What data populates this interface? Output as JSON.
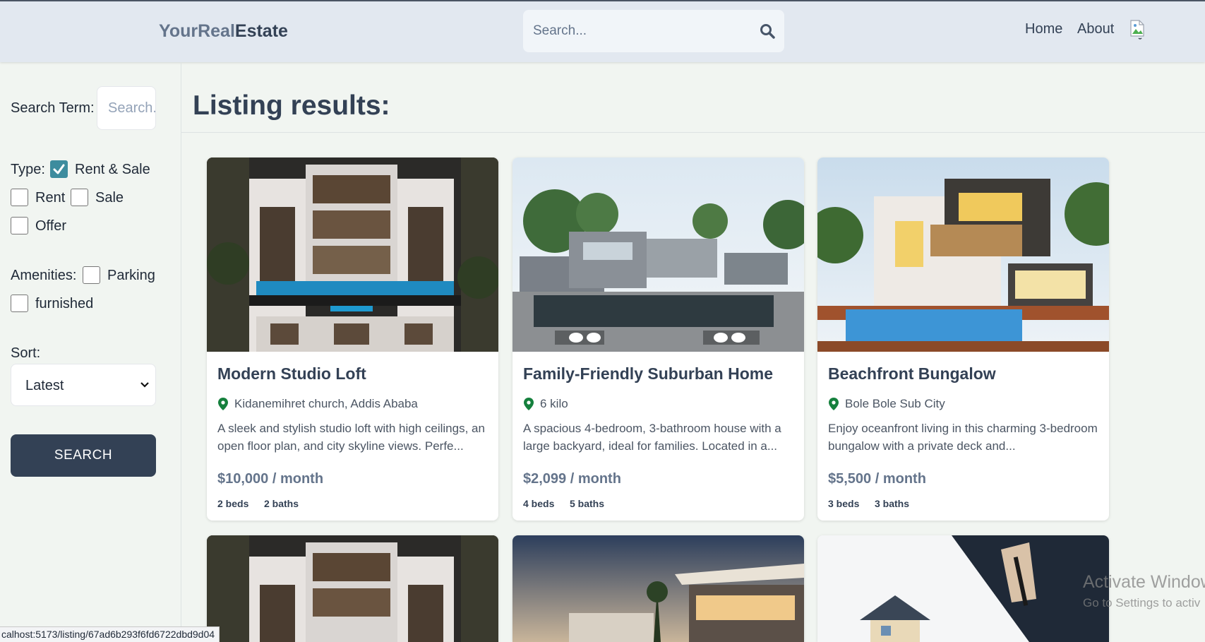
{
  "header": {
    "logo_part1": "YourReal",
    "logo_part2": "Estate",
    "search_placeholder": "Search...",
    "nav": [
      "Home",
      "About"
    ]
  },
  "sidebar": {
    "search_term_label": "Search Term:",
    "search_term_placeholder": "Search...",
    "type_label": "Type:",
    "type_options": [
      {
        "label": "Rent & Sale",
        "checked": true
      },
      {
        "label": "Rent",
        "checked": false
      },
      {
        "label": "Sale",
        "checked": false
      },
      {
        "label": "Offer",
        "checked": false
      }
    ],
    "amenities_label": "Amenities:",
    "amenities": [
      {
        "label": "Parking",
        "checked": false
      },
      {
        "label": "furnished",
        "checked": false
      }
    ],
    "sort_label": "Sort:",
    "sort_value": "Latest",
    "search_button": "SEARCH"
  },
  "main": {
    "title": "Listing results:",
    "listings": [
      {
        "name": "Modern Studio Loft",
        "location": "Kidanemihret church, Addis Ababa",
        "description": "A sleek and stylish studio loft with high ceilings, an open floor plan, and city skyline views. Perfe...",
        "price": "$10,000 / month",
        "beds": "2 beds",
        "baths": "2 baths"
      },
      {
        "name": "Family-Friendly Suburban Home",
        "location": "6 kilo",
        "description": "A spacious 4-bedroom, 3-bathroom house with a large backyard, ideal for families. Located in a...",
        "price": "$2,099 / month",
        "beds": "4 beds",
        "baths": "5 baths"
      },
      {
        "name": "Beachfront Bungalow",
        "location": "Bole Bole Sub City",
        "description": "Enjoy oceanfront living in this charming 3-bedroom bungalow with a private deck and...",
        "price": "$5,500 / month",
        "beds": "3 beds",
        "baths": "3 baths"
      }
    ]
  },
  "statusbar": "calhost:5173/listing/67ad6b293f6fd6722dbd9d04",
  "watermark": {
    "line1": "Activate Window",
    "line2": "Go to Settings to activ"
  },
  "colors": {
    "header_bg": "#e2e8f0",
    "page_bg": "#f1f5f1",
    "button_bg": "#334155",
    "checkbox_accent": "#3d8c9e",
    "pin_green": "#15803d"
  }
}
